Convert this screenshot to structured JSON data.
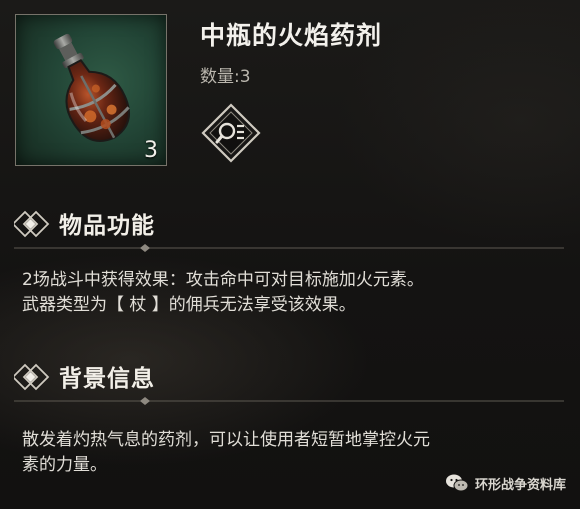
{
  "item": {
    "name": "中瓶的火焰药剂",
    "quantity_label": "数量:3",
    "icon_count": "3",
    "icon": "fire-potion-bottle-icon",
    "inspect_icon": "magnifier-list-icon"
  },
  "sections": [
    {
      "title": "物品功能",
      "icon": "double-diamond-icon",
      "lines": [
        "2场战斗中获得效果：攻击命中可对目标施加火元素。",
        "武器类型为【 杖 】的佣兵无法享受该效果。"
      ]
    },
    {
      "title": "背景信息",
      "icon": "double-diamond-icon",
      "lines": [
        "散发着灼热气息的药剂，可以让使用者短暂地掌控火元",
        "素的力量。"
      ]
    }
  ],
  "watermark": {
    "text": "环形战争资料库",
    "icon": "wechat-logo-icon"
  },
  "colors": {
    "background": "#141312",
    "frame_border": "#77736a",
    "icon_bg": "#224536",
    "text_primary": "#f3f1ec",
    "text_secondary": "#bab6ad"
  }
}
